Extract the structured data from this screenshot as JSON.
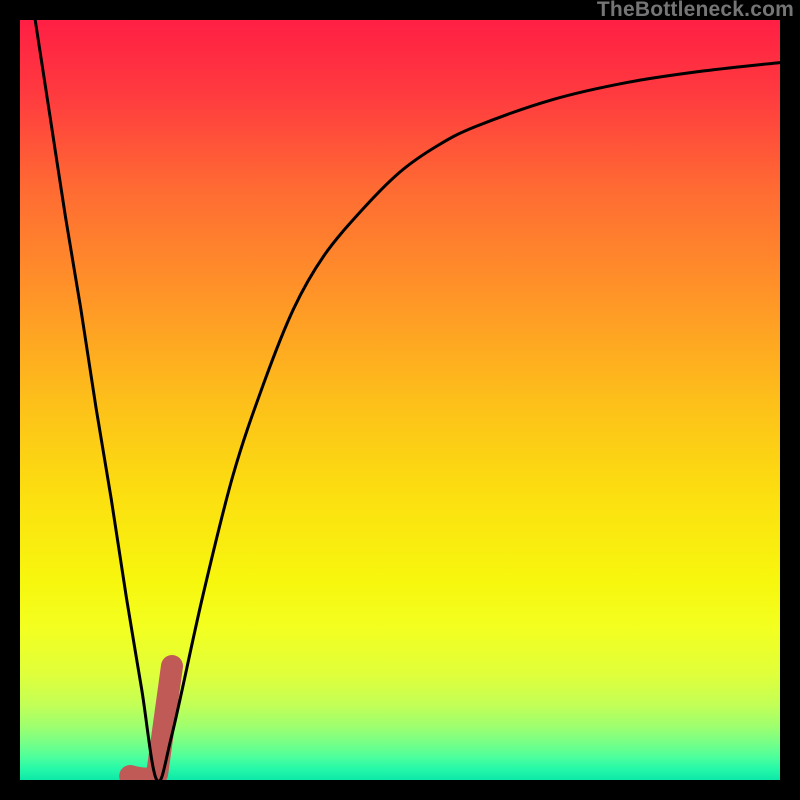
{
  "attribution": "TheBottleneck.com",
  "gradient_stops": [
    {
      "pos": 0.0,
      "color": "#ff1f44"
    },
    {
      "pos": 0.1,
      "color": "#ff3b3f"
    },
    {
      "pos": 0.22,
      "color": "#ff6a33"
    },
    {
      "pos": 0.38,
      "color": "#ff9a26"
    },
    {
      "pos": 0.5,
      "color": "#fdbf1a"
    },
    {
      "pos": 0.62,
      "color": "#fcde10"
    },
    {
      "pos": 0.74,
      "color": "#f7f70e"
    },
    {
      "pos": 0.8,
      "color": "#f3ff20"
    },
    {
      "pos": 0.86,
      "color": "#e0ff3a"
    },
    {
      "pos": 0.9,
      "color": "#c4ff55"
    },
    {
      "pos": 0.93,
      "color": "#9dff6f"
    },
    {
      "pos": 0.95,
      "color": "#78ff86"
    },
    {
      "pos": 0.97,
      "color": "#4dff9c"
    },
    {
      "pos": 0.985,
      "color": "#26f9a8"
    },
    {
      "pos": 1.0,
      "color": "#0de8a8"
    }
  ],
  "chart_data": {
    "type": "line",
    "title": "",
    "xlabel": "",
    "ylabel": "",
    "xlim": [
      0,
      100
    ],
    "ylim": [
      0,
      100
    ],
    "series": [
      {
        "name": "bottleneck-curve",
        "x": [
          2,
          4,
          6,
          8,
          10,
          12,
          14,
          16,
          18,
          20,
          24,
          28,
          32,
          36,
          40,
          45,
          50,
          55,
          60,
          70,
          80,
          90,
          100
        ],
        "y": [
          100,
          87,
          74,
          62,
          49,
          37,
          24,
          12,
          0,
          6,
          24,
          40,
          52,
          62,
          69,
          75,
          80,
          83.5,
          86,
          89.5,
          91.8,
          93.3,
          94.4
        ]
      }
    ],
    "marker": {
      "name": "red-marker",
      "x_range": [
        14.5,
        20.0
      ],
      "y_range": [
        0,
        15
      ],
      "color": "#c05a57"
    }
  }
}
